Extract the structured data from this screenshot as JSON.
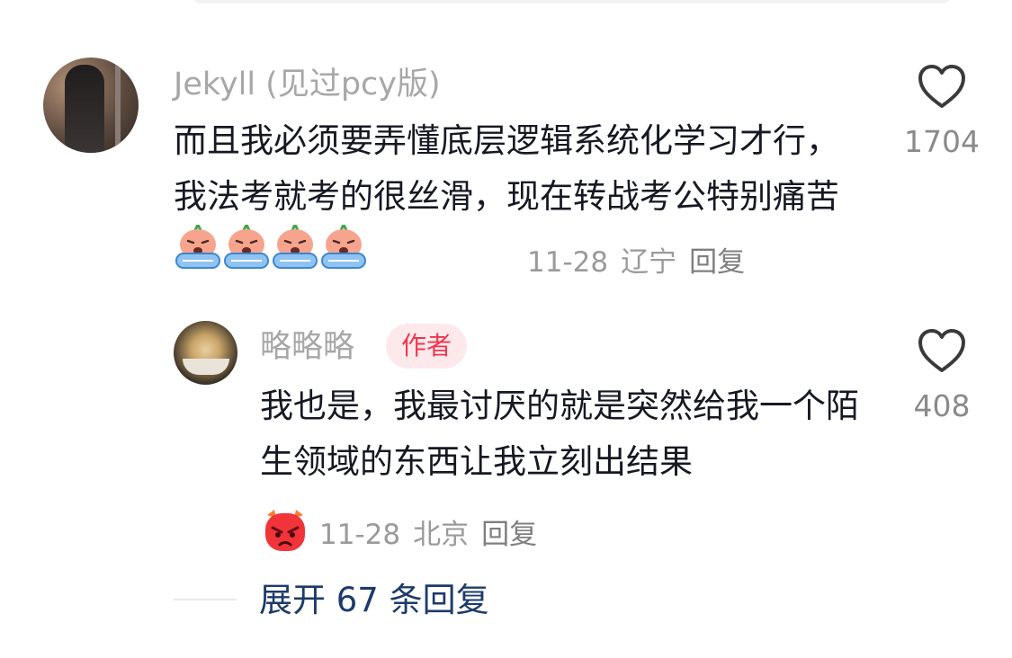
{
  "comment": {
    "username": "Jekyll (见过pcy版)",
    "text": "而且我必须要弄懂底层逻辑系统化学习才行，我法考就考的很丝滑，现在转战考公特别痛苦",
    "emojis": [
      "crying-emoji",
      "crying-emoji",
      "crying-emoji",
      "crying-emoji"
    ],
    "date": "11-28",
    "location": "辽宁",
    "reply_label": "回复",
    "like_count": "1704"
  },
  "reply": {
    "username": "略略略",
    "author_tag": "作者",
    "text": "我也是，我最讨厌的就是突然给我一个陌生领域的东西让我立刻出结果",
    "emoji": "angry-emoji",
    "date": "11-28",
    "location": "北京",
    "reply_label": "回复",
    "like_count": "408"
  },
  "expand_label": "展开 67 条回复",
  "colors": {
    "username": "#a7a7a7",
    "text": "#161823",
    "author_tag_bg": "#fde9ec",
    "author_tag_text": "#f0364e",
    "expand_link": "#1d3a6b"
  }
}
